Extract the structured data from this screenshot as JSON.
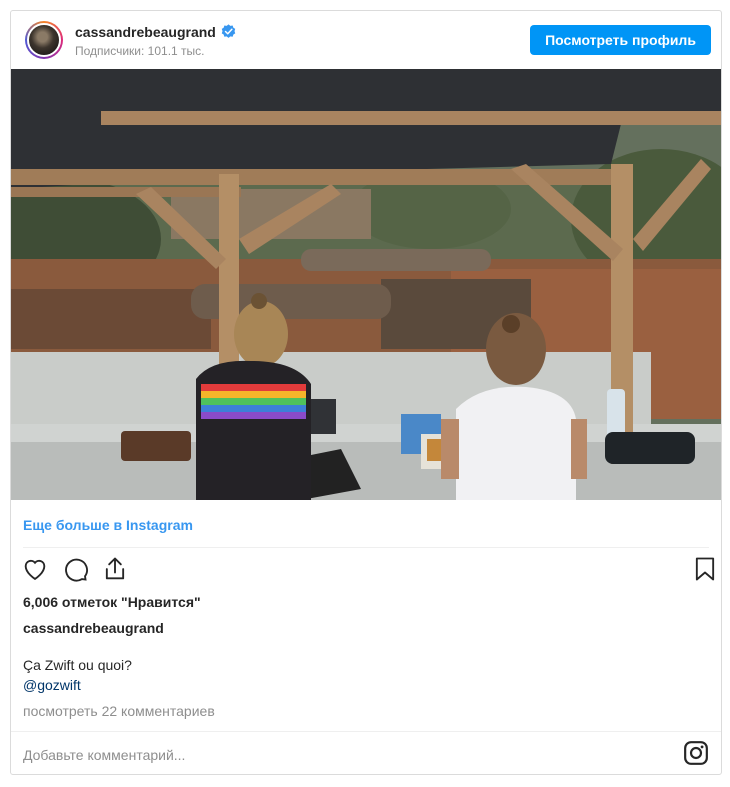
{
  "header": {
    "username": "cassandrebeaugrand",
    "followers": "Подписчики: 101.1 тыс.",
    "profile_button": "Посмотреть профиль",
    "verified_icon": "verified-badge-icon"
  },
  "links": {
    "more_on_instagram": "Еще больше в Instagram",
    "view_comments": "посмотреть 22 комментариев"
  },
  "post": {
    "likes": "6,006 отметок \"Нравится\"",
    "caption_user": "cassandrebeaugrand",
    "caption_text": "Ça Zwift ou quoi?",
    "caption_mention": "@gozwift"
  },
  "comment_box": {
    "placeholder": "Добавьте комментарий..."
  },
  "icons": {
    "like": "heart-icon",
    "comment": "comment-icon",
    "share": "share-icon",
    "save": "bookmark-icon",
    "instagram": "instagram-logo-icon"
  },
  "colors": {
    "accent": "#0095f6",
    "link": "#3897f0",
    "mention": "#003569",
    "muted": "#8e8e8e",
    "border": "#dbdbdb"
  }
}
